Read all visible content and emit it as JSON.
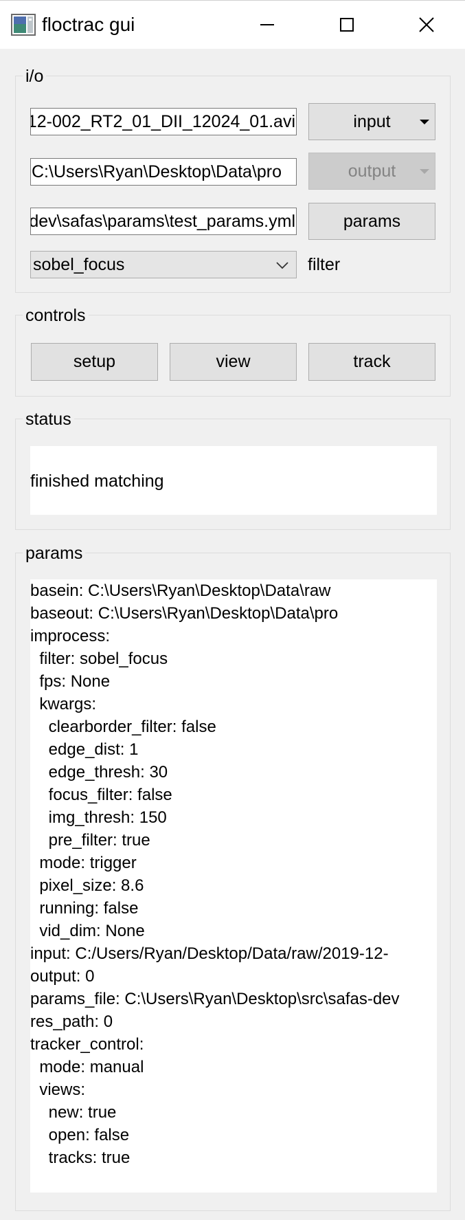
{
  "window": {
    "title": "floctrac gui",
    "controls": {
      "minimize_icon": "minimize-icon",
      "maximize_icon": "maximize-icon",
      "close_icon": "close-icon"
    }
  },
  "io": {
    "group_label": "i/o",
    "input_path": "C:/Users/Ryan/Desktop/Data/raw/2019-12-002_RT2_01_DII_12024_01.avi",
    "input_button": "input",
    "output_path": "C:\\Users\\Ryan\\Desktop\\Data\\pro",
    "output_button": "output",
    "params_path": "C:\\Users\\Ryan\\Desktop\\src\\safas-dev\\safas\\params\\test_params.yml",
    "params_button": "params",
    "filter_value": "sobel_focus",
    "filter_label": "filter"
  },
  "controls": {
    "group_label": "controls",
    "setup": "setup",
    "view": "view",
    "track": "track"
  },
  "status": {
    "group_label": "status",
    "text": "finished matching"
  },
  "params": {
    "group_label": "params",
    "text": "basein: C:\\Users\\Ryan\\Desktop\\Data\\raw\nbaseout: C:\\Users\\Ryan\\Desktop\\Data\\pro\nimprocess:\n  filter: sobel_focus\n  fps: None\n  kwargs:\n    clearborder_filter: false\n    edge_dist: 1\n    edge_thresh: 30\n    focus_filter: false\n    img_thresh: 150\n    pre_filter: true\n  mode: trigger\n  pixel_size: 8.6\n  running: false\n  vid_dim: None\ninput: C:/Users/Ryan/Desktop/Data/raw/2019-12-\noutput: 0\nparams_file: C:\\Users\\Ryan\\Desktop\\src\\safas-dev\nres_path: 0\ntracker_control:\n  mode: manual\n  views:\n    new: true\n    open: false\n    tracks: true"
  },
  "colors": {
    "background": "#f0f0f0",
    "button": "#e1e1e1",
    "disabled_button": "#cccccc",
    "disabled_text": "#838383"
  }
}
